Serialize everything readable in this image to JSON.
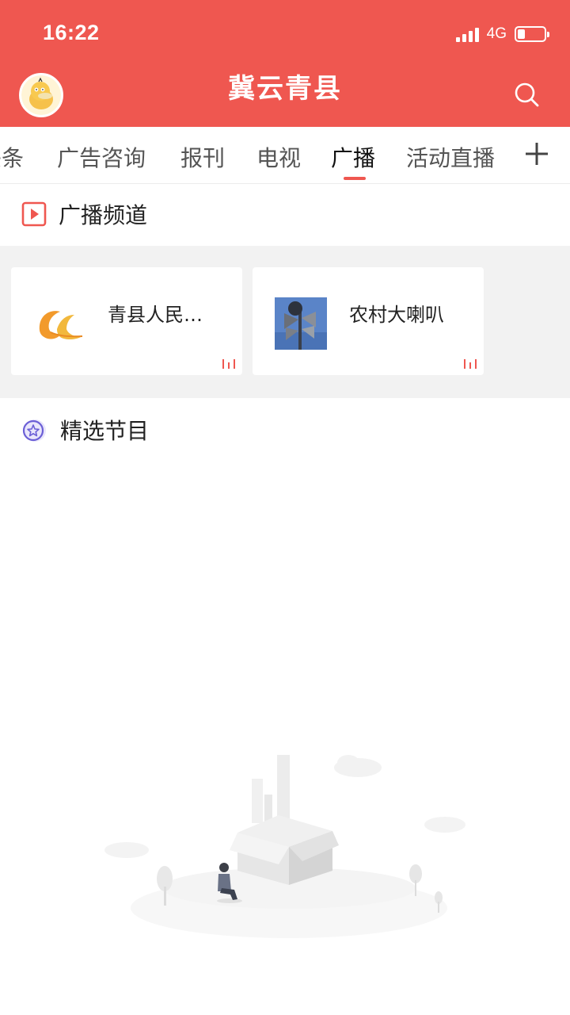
{
  "status_bar": {
    "time": "16:22",
    "network": "4G",
    "battery_level": 0.25
  },
  "header": {
    "title": "冀云青县",
    "avatar_icon": "duck-avatar-icon",
    "search_icon": "search-icon"
  },
  "tabs": {
    "items": [
      {
        "label": "头条",
        "active": false
      },
      {
        "label": "广告咨询",
        "active": false
      },
      {
        "label": "报刊",
        "active": false
      },
      {
        "label": "电视",
        "active": false
      },
      {
        "label": "广播",
        "active": true
      },
      {
        "label": "活动直播",
        "active": false
      }
    ],
    "add_icon": "plus-icon"
  },
  "broadcast_section": {
    "title": "广播频道",
    "icon": "play-box-icon",
    "channels": [
      {
        "name": "青县人民…",
        "thumb_icon": "qingxian-logo-icon"
      },
      {
        "name": "农村大喇叭",
        "thumb_icon": "loudspeaker-photo-icon"
      }
    ]
  },
  "featured_section": {
    "title": "精选节目",
    "icon": "star-badge-icon"
  },
  "empty_state": {
    "icon": "empty-box-illustration"
  },
  "colors": {
    "accent": "#ef5750",
    "tab_indicator": "#ef5750",
    "card_bg": "#ffffff",
    "channel_area_bg": "#f2f2f2"
  }
}
